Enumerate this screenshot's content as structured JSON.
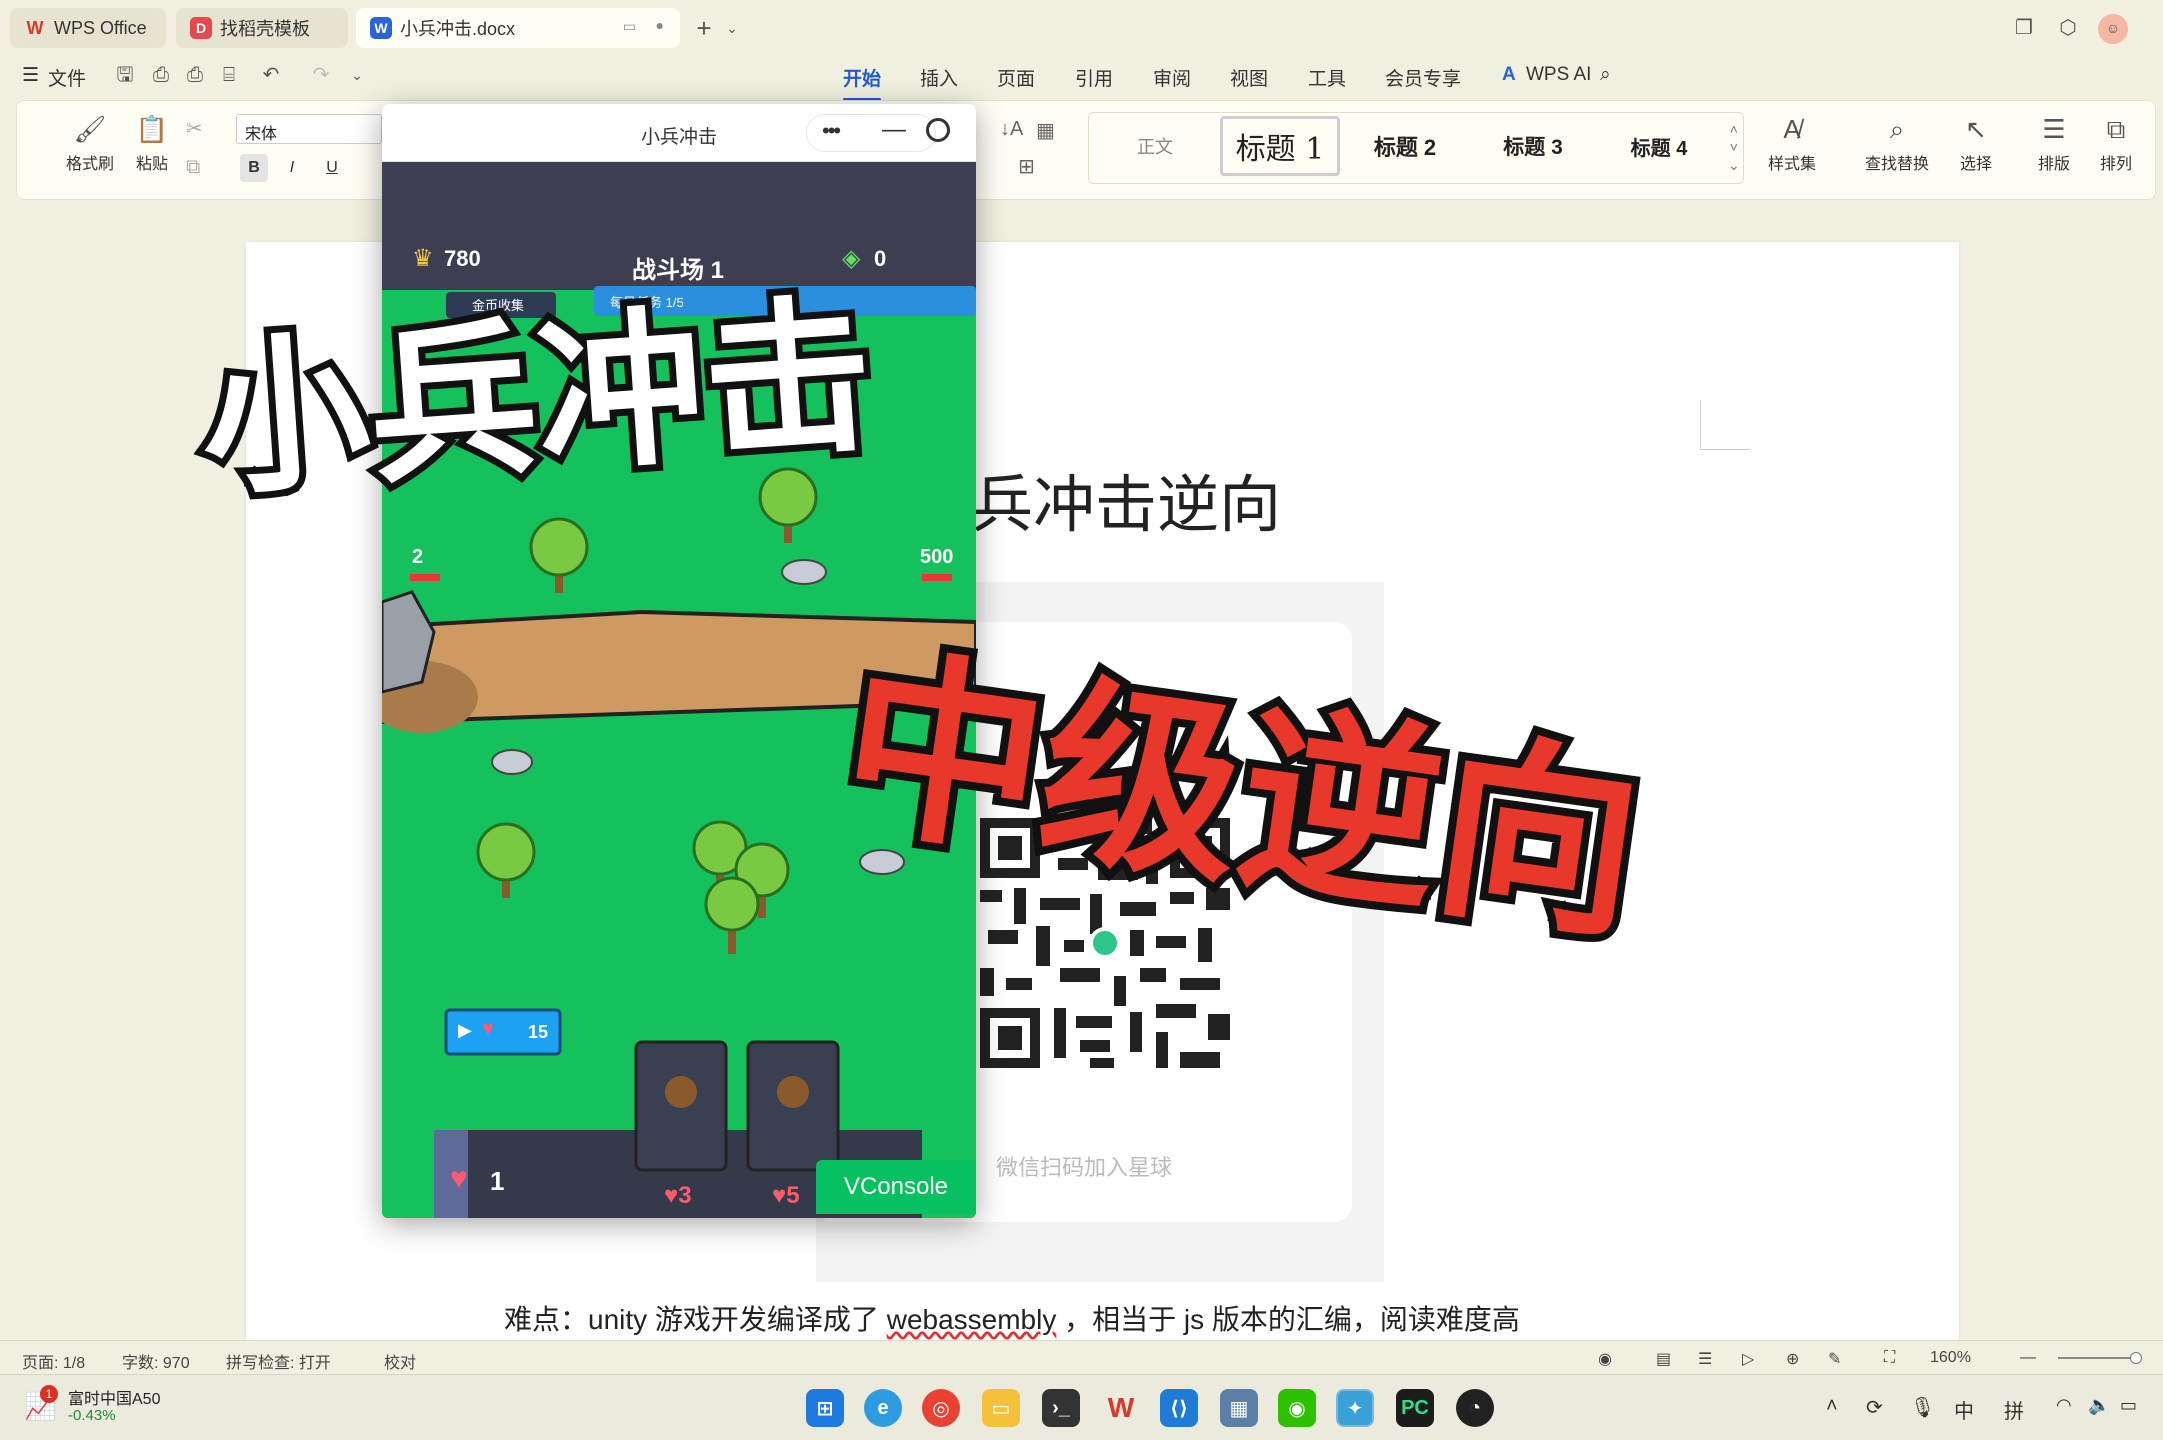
{
  "tabs": {
    "tab1": "WPS Office",
    "tab2": "找稻壳模板",
    "tab3": "小兵冲击.docx",
    "new_tab": "+"
  },
  "menu": {
    "file": "文件",
    "items": [
      "开始",
      "插入",
      "页面",
      "引用",
      "审阅",
      "视图",
      "工具",
      "会员专享"
    ],
    "wps_ai": "WPS AI"
  },
  "ribbon": {
    "format_painter": "格式刷",
    "paste": "粘贴",
    "font_name": "宋体",
    "bold": "B",
    "italic": "I",
    "underline": "U",
    "styles": [
      "正文",
      "标题 1",
      "标题 2",
      "标题 3",
      "标题 4"
    ],
    "style_set": "样式集",
    "find_replace": "查找替换",
    "select": "选择",
    "layout": "排版",
    "arrange": "排列"
  },
  "document": {
    "heading": "兵冲击逆向",
    "qr_caption": "微信扫码加入星球",
    "body_prefix": "难点：unity 游戏开发编译成了 ",
    "body_link": "webassembly",
    "body_suffix": " ，相当于 js 版本的汇编，阅读难度高"
  },
  "mini_program": {
    "title": "小兵冲击",
    "coins": "780",
    "arena": "战斗场 1",
    "gems": "0",
    "gold_collect": "金币收集",
    "daily_task": "每日任务 1/5",
    "left_base_hp": "2",
    "right_base_hp": "500",
    "ad_reward": "15",
    "slot1_cost": "1",
    "slot2_cost": "3",
    "slot3_cost": "5",
    "vconsole": "VConsole"
  },
  "overlay": {
    "title_black": "小兵冲击",
    "title_red": "中级逆向"
  },
  "status": {
    "page": "页面: 1/8",
    "words": "字数: 970",
    "spell": "拼写检查: 打开",
    "proof": "校对",
    "zoom": "160%"
  },
  "taskbar": {
    "stock_name": "富时中国A50",
    "stock_change": "-0.43%",
    "stock_badge": "1",
    "ime1": "中",
    "ime2": "拼"
  },
  "colors": {
    "accent": "#1f5bd6",
    "overlay_red": "#e8382c",
    "game_green": "#14c15c",
    "game_topbar": "#3d3e52"
  }
}
